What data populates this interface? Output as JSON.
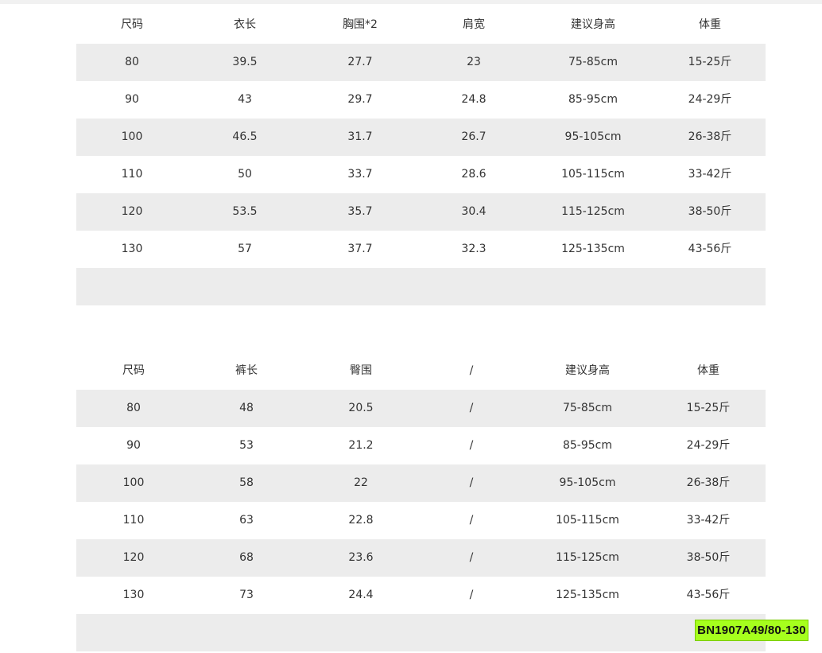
{
  "top_table": {
    "headers": [
      "尺码",
      "衣长",
      "胸围*2",
      "肩宽",
      "建议身高",
      "体重"
    ],
    "rows": [
      [
        "80",
        "39.5",
        "27.7",
        "23",
        "75-85cm",
        "15-25斤"
      ],
      [
        "90",
        "43",
        "29.7",
        "24.8",
        "85-95cm",
        "24-29斤"
      ],
      [
        "100",
        "46.5",
        "31.7",
        "26.7",
        "95-105cm",
        "26-38斤"
      ],
      [
        "110",
        "50",
        "33.7",
        "28.6",
        "105-115cm",
        "33-42斤"
      ],
      [
        "120",
        "53.5",
        "35.7",
        "30.4",
        "115-125cm",
        "38-50斤"
      ],
      [
        "130",
        "57",
        "37.7",
        "32.3",
        "125-135cm",
        "43-56斤"
      ]
    ]
  },
  "bottom_table": {
    "headers": [
      "尺码",
      "裤长",
      "臀围",
      "/",
      "建议身高",
      "体重"
    ],
    "rows": [
      [
        "80",
        "48",
        "20.5",
        "/",
        "75-85cm",
        "15-25斤"
      ],
      [
        "90",
        "53",
        "21.2",
        "/",
        "85-95cm",
        "24-29斤"
      ],
      [
        "100",
        "58",
        "22",
        "/",
        "95-105cm",
        "26-38斤"
      ],
      [
        "110",
        "63",
        "22.8",
        "/",
        "105-115cm",
        "33-42斤"
      ],
      [
        "120",
        "68",
        "23.6",
        "/",
        "115-125cm",
        "38-50斤"
      ],
      [
        "130",
        "73",
        "24.4",
        "/",
        "125-135cm",
        "43-56斤"
      ]
    ]
  },
  "product_code": "BN1907A49/80-130",
  "colors": {
    "shaded_row": "#ececec",
    "badge_background": "#a6ff1d",
    "text": "#333333"
  }
}
